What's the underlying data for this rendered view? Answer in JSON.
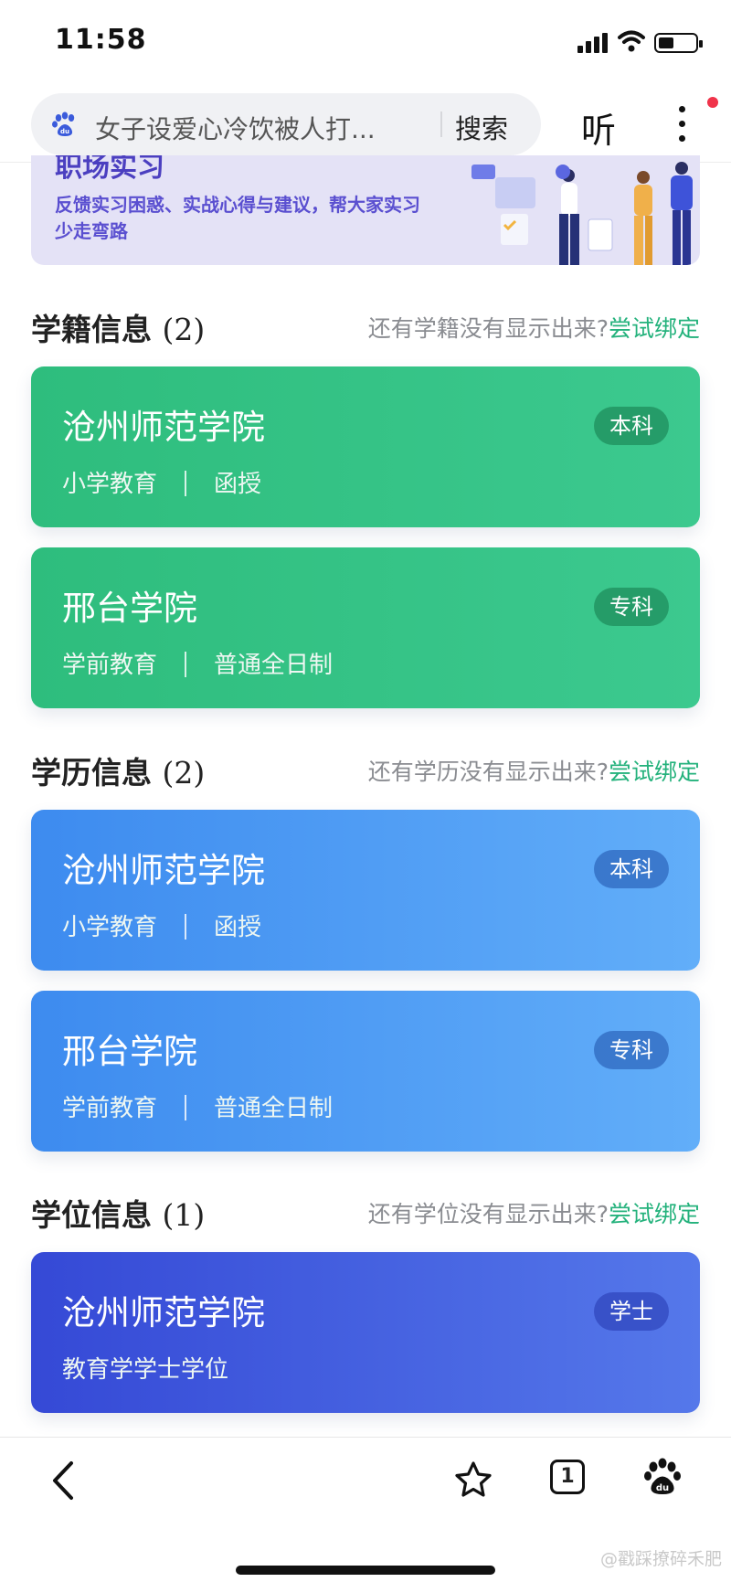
{
  "status_bar": {
    "time": "11:58"
  },
  "search": {
    "query": "女子设爱心冷饮被人打...",
    "button": "搜索"
  },
  "toolbar": {
    "listen": "听"
  },
  "banner": {
    "title": "职场实习",
    "description": "反馈实习困惑、实战心得与建议，帮大家实习少走弯路"
  },
  "sections": [
    {
      "title": "学籍信息",
      "count": "(2)",
      "hint": "还有学籍没有显示出来?",
      "bind": "尝试绑定",
      "cards": [
        {
          "school": "沧州师范学院",
          "major": "小学教育",
          "mode": "函授",
          "tag": "本科"
        },
        {
          "school": "邢台学院",
          "major": "学前教育",
          "mode": "普通全日制",
          "tag": "专科"
        }
      ]
    },
    {
      "title": "学历信息",
      "count": "(2)",
      "hint": "还有学历没有显示出来?",
      "bind": "尝试绑定",
      "cards": [
        {
          "school": "沧州师范学院",
          "major": "小学教育",
          "mode": "函授",
          "tag": "本科"
        },
        {
          "school": "邢台学院",
          "major": "学前教育",
          "mode": "普通全日制",
          "tag": "专科"
        }
      ]
    },
    {
      "title": "学位信息",
      "count": "(1)",
      "hint": "还有学位没有显示出来?",
      "bind": "尝试绑定",
      "cards": [
        {
          "school": "沧州师范学院",
          "degree": "教育学学士学位",
          "tag": "学士"
        }
      ]
    }
  ],
  "bottom_nav": {
    "tab_count": "1"
  },
  "watermark": "@戳踩撩碎禾肥",
  "colors": {
    "accent": "#24b27c",
    "green": "#2ebd7d",
    "blue": "#3d8bef",
    "indigo": "#3549d6"
  }
}
